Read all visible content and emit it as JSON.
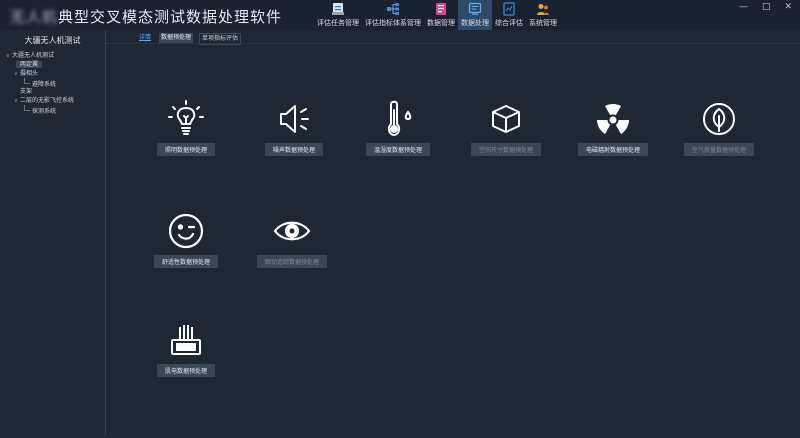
{
  "app": {
    "title_obscured": "无人机",
    "title_visible": "典型交叉模态测试数据处理软件"
  },
  "modules": [
    {
      "label": "评估任务管理",
      "icon": "task-icon",
      "active": false
    },
    {
      "label": "评估指标体系管理",
      "icon": "hierarchy-icon",
      "active": false
    },
    {
      "label": "数据管理",
      "icon": "database-icon",
      "active": false
    },
    {
      "label": "数据处理",
      "icon": "data-processing-icon",
      "active": true
    },
    {
      "label": "综合评估",
      "icon": "analysis-icon",
      "active": false
    },
    {
      "label": "系统管理",
      "icon": "users-icon",
      "active": false
    }
  ],
  "window_controls": {
    "minimize": "—",
    "maximize": "□",
    "close": "✕"
  },
  "sidebar": {
    "title": "大疆无人机测试",
    "tree": [
      {
        "label": "大疆无人机测试",
        "level": 0,
        "caret": "∨"
      },
      {
        "label": "两定翼",
        "level": 1,
        "selected": true
      },
      {
        "label": "摄相头",
        "level": 1,
        "caret": "∨"
      },
      {
        "label": "避障系统",
        "level": 2
      },
      {
        "label": "支架",
        "level": 1
      },
      {
        "label": "二层的无影飞控系统",
        "level": 1,
        "caret": "∨"
      },
      {
        "label": "探测系统",
        "level": 2
      }
    ]
  },
  "tabs": [
    {
      "label": "详情",
      "style": "home"
    },
    {
      "label": "数据预处理",
      "style": "sel"
    },
    {
      "label": "单项指标评估",
      "style": "plain"
    }
  ],
  "tiles": [
    {
      "label": "照明数据预处理",
      "icon": "light-bulb-icon",
      "disabled": false
    },
    {
      "label": "噪声数据预处理",
      "icon": "speaker-icon",
      "disabled": false
    },
    {
      "label": "温湿度数据预处理",
      "icon": "thermometer-icon",
      "disabled": false
    },
    {
      "label": "空间尺寸数据预处理",
      "icon": "cube-icon",
      "disabled": true
    },
    {
      "label": "电磁辐射数据预处理",
      "icon": "radiation-icon",
      "disabled": false
    },
    {
      "label": "空气质量数据预处理",
      "icon": "leaf-icon",
      "disabled": true
    },
    {
      "label": "舒适性数据预处理",
      "icon": "smile-icon",
      "disabled": false
    },
    {
      "label": "眼动追踪数据预处理",
      "icon": "eye-icon",
      "disabled": true
    },
    {
      "label": "肌电数据预处理",
      "icon": "emg-sensor-icon",
      "disabled": false
    }
  ]
}
